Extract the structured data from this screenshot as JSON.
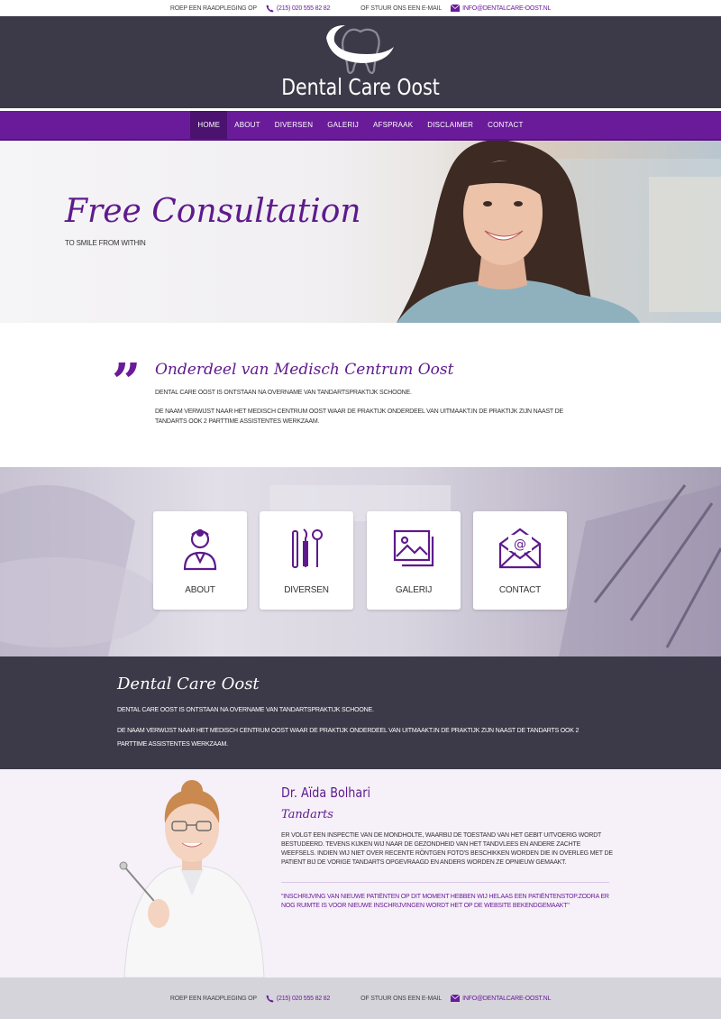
{
  "topbar": {
    "call_label": "Roep een raadpleging op",
    "phone": "(215) 020 555 82 82",
    "mail_label": "of stuur ons een e-mail",
    "email": "info@dentalcare-oost.nl"
  },
  "header": {
    "site_title": "Dental Care Oost"
  },
  "nav": {
    "items": [
      {
        "label": "Home"
      },
      {
        "label": "About"
      },
      {
        "label": "Diversen"
      },
      {
        "label": "Galerij"
      },
      {
        "label": "Afspraak"
      },
      {
        "label": "Disclaimer"
      },
      {
        "label": "Contact"
      }
    ]
  },
  "hero": {
    "title": "Free Consultation",
    "subtitle": "To smile from within"
  },
  "intro": {
    "title": "Onderdeel van Medisch Centrum Oost",
    "p1": "Dental Care Oost is ontstaan na overname van tandartspraktijk Schoone.",
    "p2": "De naam verwijst naar het Medisch Centrum Oost waar de praktijk onderdeel van uitmaakt.In de praktijk zijn naast de tandarts ook 2 parttime assistentes werkzaam."
  },
  "features": [
    {
      "label": "About",
      "icon": "dentist-icon"
    },
    {
      "label": "Diversen",
      "icon": "dental-tools-icon"
    },
    {
      "label": "Galerij",
      "icon": "gallery-icon"
    },
    {
      "label": "Contact",
      "icon": "envelope-icon"
    }
  ],
  "about": {
    "title": "Dental Care Oost",
    "p1": "Dental Care Oost is ontstaan na overname van tandartspraktijk Schoone.",
    "p2": "De naam verwijst naar het Medisch Centrum Oost waar de praktijk onderdeel van uitmaakt.In de praktijk zijn naast de tandarts ook 2 parttime assistentes werkzaam."
  },
  "doctor": {
    "name": "Dr. Aïda Bolhari",
    "role": "Tandarts",
    "text": "Er volgt een inspectie van de mondholte, waarbij de toestand van het gebit uitvoerig wordt bestudeerd. Tevens kijken wij naar de gezondheid van het tandvlees en andere zachte weefsels. Indien wij niet over recente röntgen foto's beschikken worden die in overleg met de patient bij de vorige tandarts opgevraagd en anders worden ze opnieuw gemaakt.",
    "note": "\"Inschrijving van nieuwe patiënten Op dit moment hebben wij helaas een patiëntenstop.Zodra er nog ruimte is voor nieuwe inschrijvingen wordt het op de website bekendgemaakt\""
  },
  "footer": {
    "call_label": "Roep een raadpleging op",
    "phone": "(215) 020 555 82 82",
    "mail_label": "of stuur ons een e-mail",
    "email": "info@dentalcare-oost.nl"
  },
  "colors": {
    "brand_purple": "#6a1b9a",
    "dark": "#3c3a48",
    "footer": "#d6d4db"
  }
}
